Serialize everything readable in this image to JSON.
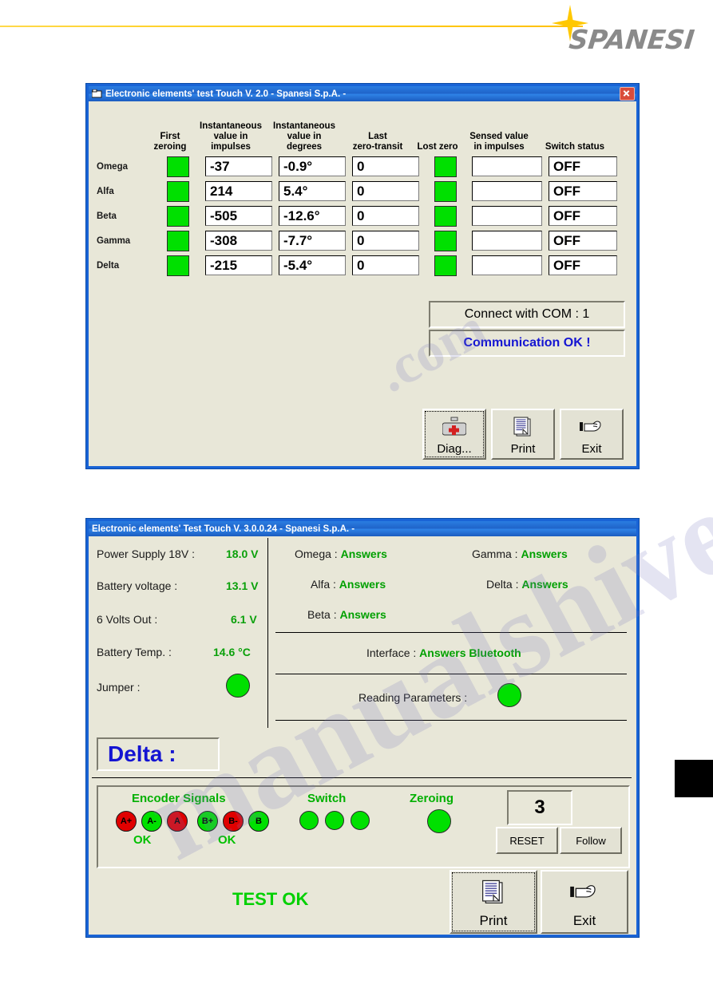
{
  "page": {
    "brand": "SPANESI",
    "brand_color": "#8a8a8a",
    "accent_color": "#ffc800"
  },
  "window1": {
    "title": "Electronic elements' test Touch V. 2.0 -  Spanesi S.p.A.  -",
    "title_icon": "window-app-icon",
    "close_icon": "close-icon",
    "columns": [
      "First\nzeroing",
      "Instantaneous value in impulses",
      "Instantaneous value in degrees",
      "Last zero-transit",
      "Lost zero",
      "Sensed value in impulses",
      "Switch status"
    ],
    "col_first_zeroing_l1": "First",
    "col_first_zeroing_l2": "zeroing",
    "col_inst_imp_l1": "Instantaneous",
    "col_inst_imp_l2": "value in",
    "col_inst_imp_l3": "impulses",
    "col_inst_deg_l1": "Instantaneous",
    "col_inst_deg_l2": "value in",
    "col_inst_deg_l3": "degrees",
    "col_last_l1": "Last",
    "col_last_l2": "zero-transit",
    "col_lost_zero": "Lost zero",
    "col_sensed_l1": "Sensed value",
    "col_sensed_l2": "in impulses",
    "col_switch": "Switch status",
    "rows": [
      {
        "label": "Omega",
        "first_zeroing": "on",
        "impulses": "-37",
        "degrees": "-0.9°",
        "last_zero": "0",
        "lost_zero": "on",
        "sensed": "",
        "switch": "OFF"
      },
      {
        "label": "Alfa",
        "first_zeroing": "on",
        "impulses": "214",
        "degrees": "5.4°",
        "last_zero": "0",
        "lost_zero": "on",
        "sensed": "",
        "switch": "OFF"
      },
      {
        "label": "Beta",
        "first_zeroing": "on",
        "impulses": "-505",
        "degrees": "-12.6°",
        "last_zero": "0",
        "lost_zero": "on",
        "sensed": "",
        "switch": "OFF"
      },
      {
        "label": "Gamma",
        "first_zeroing": "on",
        "impulses": "-308",
        "degrees": "-7.7°",
        "last_zero": "0",
        "lost_zero": "on",
        "sensed": "",
        "switch": "OFF"
      },
      {
        "label": "Delta",
        "first_zeroing": "on",
        "impulses": "-215",
        "degrees": "-5.4°",
        "last_zero": "0",
        "lost_zero": "on",
        "sensed": "",
        "switch": "OFF"
      }
    ],
    "status_com": "Connect with COM :  1",
    "status_comm": "Communication OK !",
    "status_comm_color": "#1414d2",
    "buttons": [
      {
        "label": "Diag...",
        "icon": "medical-bag-icon",
        "focused": true
      },
      {
        "label": "Print",
        "icon": "printer-page-icon",
        "focused": false
      },
      {
        "label": "Exit",
        "icon": "pointing-hand-icon",
        "focused": false
      }
    ]
  },
  "window2": {
    "title": "Electronic elements' Test Touch V. 3.0.0.24  -  Spanesi S.p.A.  -",
    "supply": [
      {
        "label": "Power Supply 18V :",
        "value": "18.0 V"
      },
      {
        "label": "Battery voltage :",
        "value": "13.1 V"
      },
      {
        "label": "6 Volts Out :",
        "value": "6.1 V"
      },
      {
        "label": "Battery Temp. :",
        "value": "14.6 °C"
      }
    ],
    "jumper_label": "Jumper :",
    "jumper_state": "on",
    "answers": [
      {
        "label": "Omega :",
        "value": "Answers"
      },
      {
        "label": "Gamma :",
        "value": "Answers"
      },
      {
        "label": "Alfa :",
        "value": "Answers"
      },
      {
        "label": "Delta :",
        "value": "Answers"
      },
      {
        "label": "Beta :",
        "value": "Answers"
      }
    ],
    "interface_label": "Interface :",
    "interface_value": "Answers Bluetooth",
    "reading_label": "Reading Parameters :",
    "reading_state": "on",
    "current_channel": "Delta :",
    "encoder_title": "Encoder Signals",
    "encoder_leds_a": [
      {
        "label": "A+",
        "state": "off"
      },
      {
        "label": "A-",
        "state": "on"
      },
      {
        "label": "A",
        "state": "off"
      }
    ],
    "encoder_leds_b": [
      {
        "label": "B+",
        "state": "on"
      },
      {
        "label": "B-",
        "state": "off"
      },
      {
        "label": "B",
        "state": "on"
      }
    ],
    "encoder_ok_a": "OK",
    "encoder_ok_b": "OK",
    "switch_title": "Switch",
    "switch_leds": [
      "on",
      "on",
      "on"
    ],
    "zeroing_title": "Zeroing",
    "zeroing_led": "on",
    "counter": "3",
    "reset_label": "RESET",
    "follow_label": "Follow",
    "test_result": "TEST OK",
    "test_result_color": "#00d000",
    "buttons": [
      {
        "label": "Print",
        "icon": "printer-page-icon",
        "focused": true
      },
      {
        "label": "Exit",
        "icon": "pointing-hand-icon",
        "focused": false
      }
    ]
  },
  "colors": {
    "led_on": "#00e000",
    "led_off": "#e00000",
    "green_text": "#00a000",
    "window_face": "#e8e7d8",
    "title_blue": "#1f63c9"
  }
}
